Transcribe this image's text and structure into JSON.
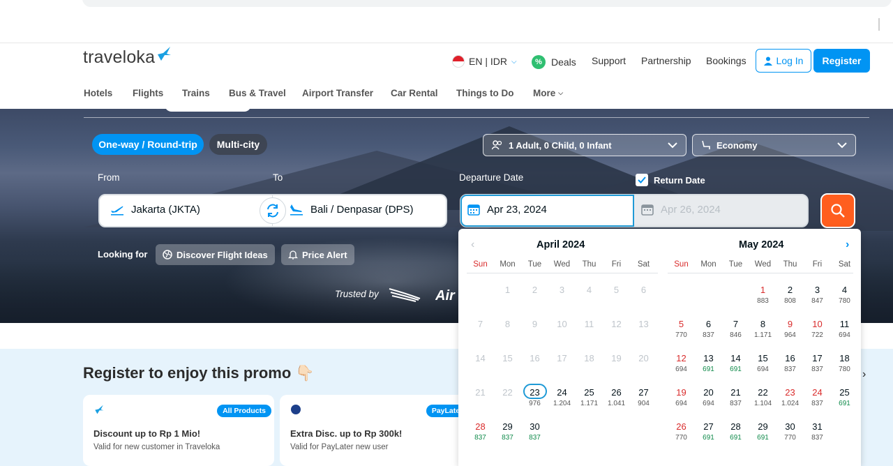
{
  "brand": {
    "name": "traveloka"
  },
  "topnav": {
    "lang": "EN | IDR",
    "deals": "Deals",
    "support": "Support",
    "partnership": "Partnership",
    "bookings": "Bookings",
    "login": "Log In",
    "register": "Register"
  },
  "subnav": [
    "Hotels",
    "Flights",
    "Trains",
    "Bus & Travel",
    "Airport Transfer",
    "Car Rental",
    "Things to Do",
    "More"
  ],
  "search": {
    "trip_types": [
      "One-way / Round-trip",
      "Multi-city"
    ],
    "passengers": "1 Adult, 0 Child, 0 Infant",
    "seat_class": "Economy",
    "from_label": "From",
    "to_label": "To",
    "departure_label": "Departure Date",
    "return_label": "Return Date",
    "from_value": "Jakarta (JKTA)",
    "to_value": "Bali / Denpasar (DPS)",
    "departure_value": "Apr 23, 2024",
    "return_value": "Apr 26, 2024",
    "looking_for": "Looking for",
    "discover": "Discover Flight Ideas",
    "price_alert": "Price Alert",
    "trusted_by": "Trusted by"
  },
  "calendar": {
    "weekdays": [
      "Sun",
      "Mon",
      "Tue",
      "Wed",
      "Thu",
      "Fri",
      "Sat"
    ],
    "months": [
      {
        "title": "April 2024",
        "days": [
          [
            "",
            "",
            "",
            "",
            "",
            "",
            ""
          ],
          [
            "1",
            "2",
            "3",
            "4",
            "5",
            "6"
          ],
          [
            "7",
            "8",
            "9",
            "10",
            "11",
            "12",
            "13"
          ],
          [
            "14",
            "15",
            "16",
            "17",
            "18",
            "19",
            "20"
          ],
          [
            "21",
            "22",
            "23",
            "24",
            "25",
            "26",
            "27"
          ],
          [
            "28",
            "29",
            "30"
          ]
        ],
        "prices": {
          "23": "976",
          "24": "1.204",
          "25": "1.171",
          "26": "1.041",
          "27": "904",
          "28": "837",
          "29": "837",
          "30": "837"
        }
      },
      {
        "title": "May 2024",
        "prices": {
          "1": "883",
          "2": "808",
          "3": "847",
          "4": "780",
          "5": "770",
          "6": "837",
          "7": "846",
          "8": "1.171",
          "9": "964",
          "10": "722",
          "11": "694",
          "12": "694",
          "13": "691",
          "14": "691",
          "15": "694",
          "16": "837",
          "17": "837",
          "18": "780",
          "19": "694",
          "20": "694",
          "21": "837",
          "22": "1.104",
          "23": "1.024",
          "24": "837",
          "25": "691",
          "26": "770",
          "27": "691",
          "28": "691",
          "29": "691",
          "30": "770",
          "31": "837"
        }
      }
    ]
  },
  "promo": {
    "title": "Register to enjoy this promo 👇🏻",
    "cards": [
      {
        "badge": "All Products",
        "title": "Discount up to Rp 1 Mio!",
        "sub": "Valid for new customer in Traveloka"
      },
      {
        "badge": "PayLater",
        "title": "Extra Disc. up to Rp 300k!",
        "sub": "Valid for PayLater new user"
      }
    ]
  },
  "colors": {
    "brand_blue": "#0194f3",
    "search_orange": "#ff5e1f",
    "holiday_red": "#d92b2b",
    "cheap_green": "#0f8a4a"
  }
}
